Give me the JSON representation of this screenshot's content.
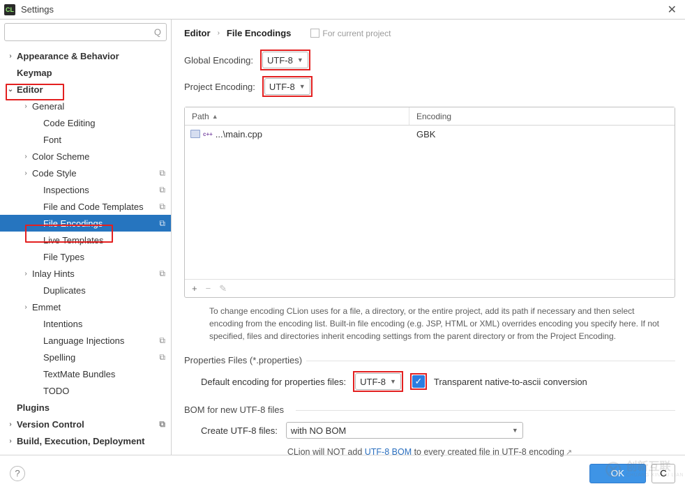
{
  "window": {
    "title": "Settings"
  },
  "search": {
    "placeholder": ""
  },
  "sidebar": {
    "items": [
      {
        "label": "Appearance & Behavior",
        "arrow": "›",
        "bold": true,
        "level": 1
      },
      {
        "label": "Keymap",
        "arrow": "",
        "bold": true,
        "level": 1
      },
      {
        "label": "Editor",
        "arrow": "⌄",
        "bold": true,
        "level": 1
      },
      {
        "label": "General",
        "arrow": "›",
        "level": 2
      },
      {
        "label": "Code Editing",
        "level": 3
      },
      {
        "label": "Font",
        "level": 3
      },
      {
        "label": "Color Scheme",
        "arrow": "›",
        "level": 2
      },
      {
        "label": "Code Style",
        "arrow": "›",
        "level": 2,
        "copy": true
      },
      {
        "label": "Inspections",
        "level": 3,
        "copy": true
      },
      {
        "label": "File and Code Templates",
        "level": 3,
        "copy": true
      },
      {
        "label": "File Encodings",
        "level": 3,
        "copy": true,
        "selected": true
      },
      {
        "label": "Live Templates",
        "level": 3
      },
      {
        "label": "File Types",
        "level": 3
      },
      {
        "label": "Inlay Hints",
        "arrow": "›",
        "level": 2,
        "copy": true
      },
      {
        "label": "Duplicates",
        "level": 3
      },
      {
        "label": "Emmet",
        "arrow": "›",
        "level": 2
      },
      {
        "label": "Intentions",
        "level": 3
      },
      {
        "label": "Language Injections",
        "level": 3,
        "copy": true
      },
      {
        "label": "Spelling",
        "level": 3,
        "copy": true
      },
      {
        "label": "TextMate Bundles",
        "level": 3
      },
      {
        "label": "TODO",
        "level": 3
      },
      {
        "label": "Plugins",
        "bold": true,
        "level": 1
      },
      {
        "label": "Version Control",
        "arrow": "›",
        "bold": true,
        "level": 1,
        "copy": true
      },
      {
        "label": "Build, Execution, Deployment",
        "arrow": "›",
        "bold": true,
        "level": 1
      }
    ]
  },
  "breadcrumb": {
    "a": "Editor",
    "b": "File Encodings",
    "scope": "For current project"
  },
  "global_encoding": {
    "label": "Global Encoding:",
    "value": "UTF-8"
  },
  "project_encoding": {
    "label": "Project Encoding:",
    "value": "UTF-8"
  },
  "table": {
    "col_path": "Path",
    "col_enc": "Encoding",
    "rows": [
      {
        "path": "...\\main.cpp",
        "enc": "GBK"
      }
    ]
  },
  "desc": "To change encoding CLion uses for a file, a directory, or the entire project, add its path if necessary and then select encoding from the encoding list. Built-in file encoding (e.g. JSP, HTML or XML) overrides encoding you specify here. If not specified, files and directories inherit encoding settings from the parent directory or from the Project Encoding.",
  "props_section": {
    "title": "Properties Files (*.properties)",
    "label": "Default encoding for properties files:",
    "value": "UTF-8",
    "checkbox": "Transparent native-to-ascii conversion"
  },
  "bom_section": {
    "title": "BOM for new UTF-8 files",
    "label": "Create UTF-8 files:",
    "value": "with NO BOM",
    "note_a": "CLion will NOT add ",
    "note_link": "UTF-8 BOM",
    "note_b": " to every created file in UTF-8 encoding"
  },
  "footer": {
    "ok": "OK",
    "cancel": "C"
  },
  "watermark": {
    "zh": "创新互联",
    "en": "CHUANG XIN HU LIAN"
  }
}
